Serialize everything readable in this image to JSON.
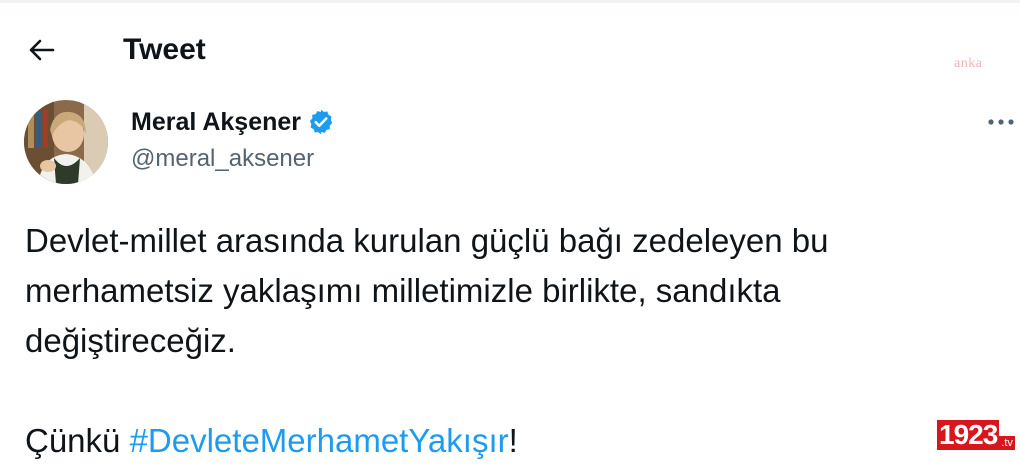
{
  "header": {
    "back_icon": "arrow-left-icon",
    "title": "Tweet"
  },
  "watermark_top": "anka",
  "author": {
    "name": "Meral Akşener",
    "handle": "@meral_aksener",
    "verified_icon": "verified-badge-icon",
    "verified_color": "#1d9bf0"
  },
  "more_icon": "more-horizontal-icon",
  "tweet": {
    "line1": "Devlet-millet arasında kurulan güçlü bağı zedeleyen bu",
    "line2": "merhametsiz yaklaşımı milletimizle birlikte, sandıkta",
    "line3": "değiştireceğiz.",
    "line4_prefix": "Çünkü ",
    "hashtag": "#DevleteMerhametYakışır",
    "line4_suffix": "!",
    "hashtag_color": "#1d9bf0"
  },
  "watermark_bottom": {
    "number": "1923",
    "suffix": ".tv",
    "color": "#d7161d"
  }
}
